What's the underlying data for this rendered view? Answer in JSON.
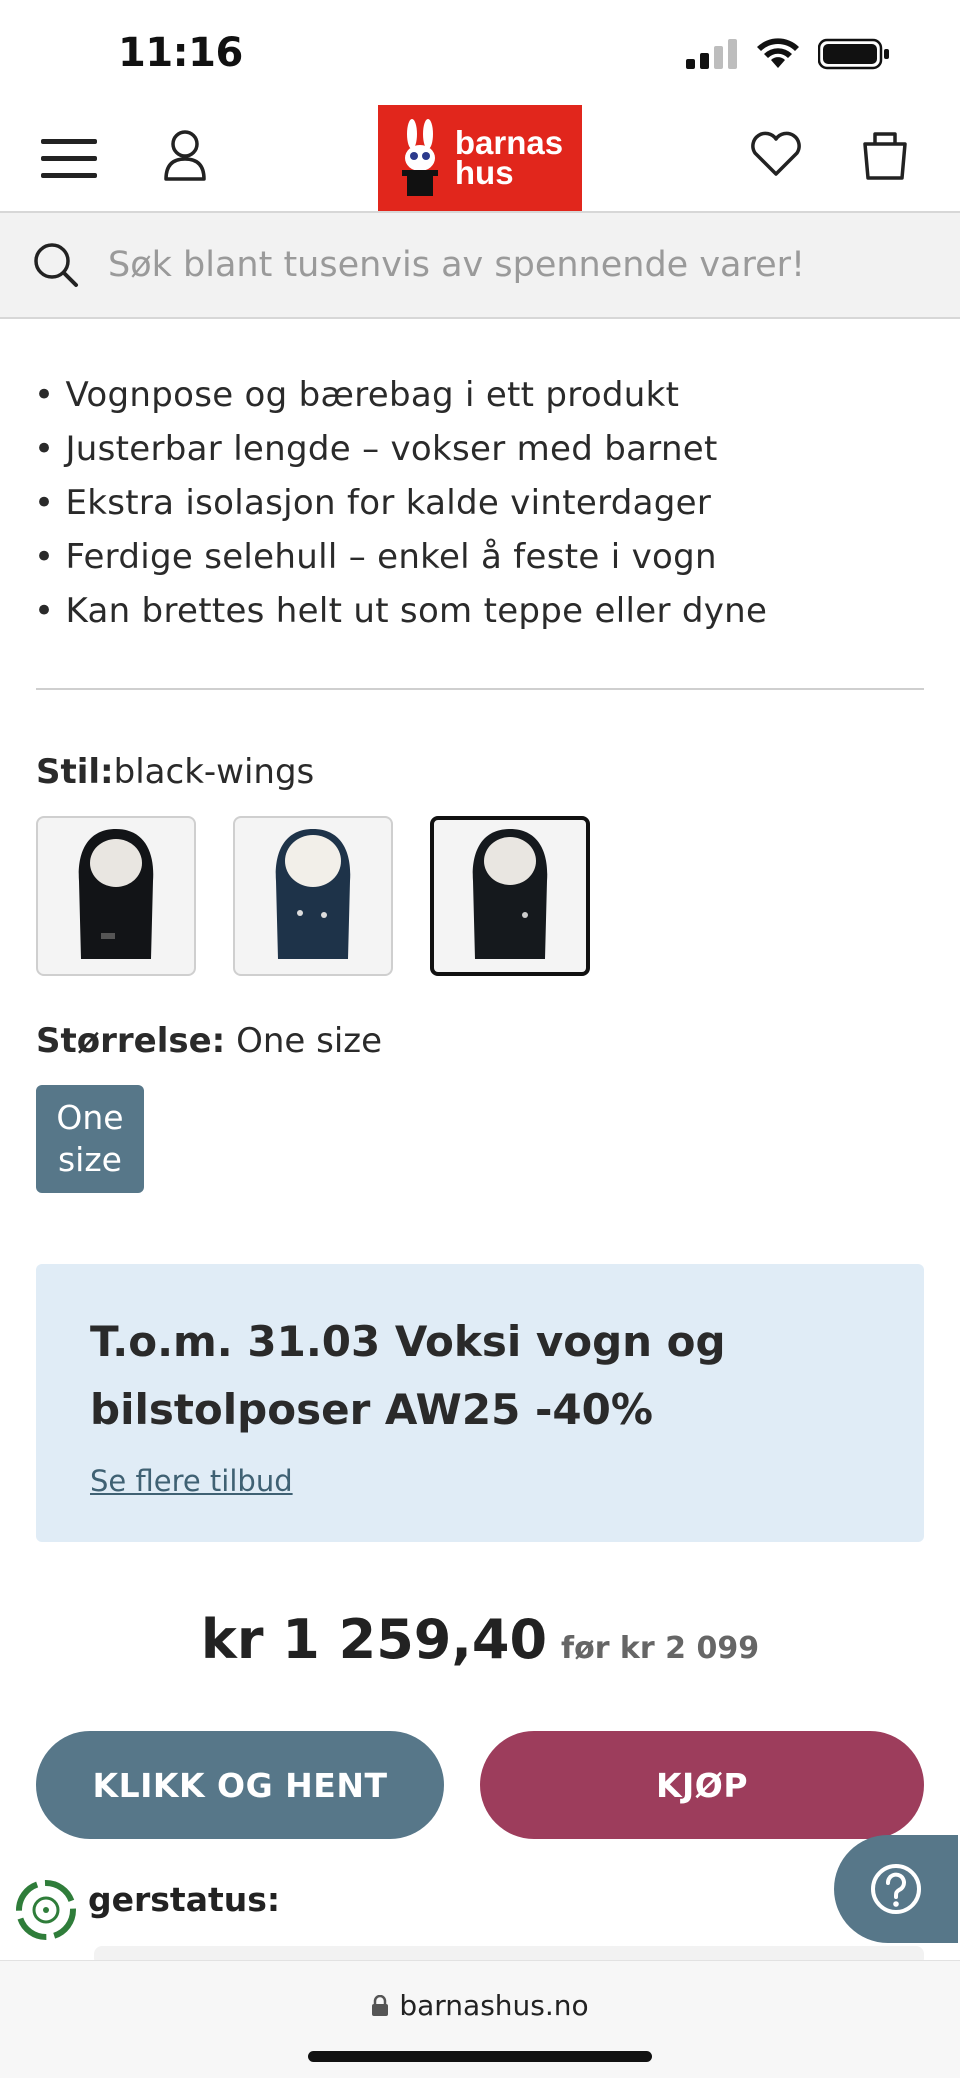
{
  "status_bar": {
    "time": "11:16"
  },
  "header": {
    "logo_line1": "barnas",
    "logo_line2": "hus",
    "brand_color": "#e1261c",
    "icons": [
      "menu-icon",
      "account-icon",
      "heart-icon",
      "cart-icon"
    ]
  },
  "search": {
    "placeholder": "Søk blant tusenvis av spennende varer!"
  },
  "features": [
    "Vognpose og bærebag i ett produkt",
    "Justerbar lengde – vokser med barnet",
    "Ekstra isolasjon for kalde vinterdager",
    "Ferdige selehull – enkel å feste i vogn",
    "Kan brettes helt ut som teppe eller dyne"
  ],
  "style": {
    "label": "Stil:",
    "value": "black-wings",
    "swatches": [
      {
        "color": "#121417",
        "selected": false
      },
      {
        "color": "#1e3349",
        "selected": false
      },
      {
        "color": "#15191d",
        "selected": true
      }
    ]
  },
  "size": {
    "label": "Størrelse:",
    "value": "One size",
    "button_line1": "One",
    "button_line2": "size"
  },
  "promo": {
    "title": "T.o.m. 31.03 Voksi vogn og bilstolposer AW25 -40%",
    "link": "Se flere tilbud"
  },
  "price": {
    "current": "kr 1 259,40",
    "before": "før kr 2 099"
  },
  "actions": {
    "pickup": "KLIKK OG HENT",
    "buy": "KJØP"
  },
  "stock": {
    "label": "Lagerstatus:",
    "visible_label": "gerstatus:"
  },
  "browser": {
    "url": "barnashus.no"
  },
  "colors": {
    "accent_blue": "#577789",
    "buy": "#9d3d5c",
    "promo_bg": "#e0ecf6"
  }
}
